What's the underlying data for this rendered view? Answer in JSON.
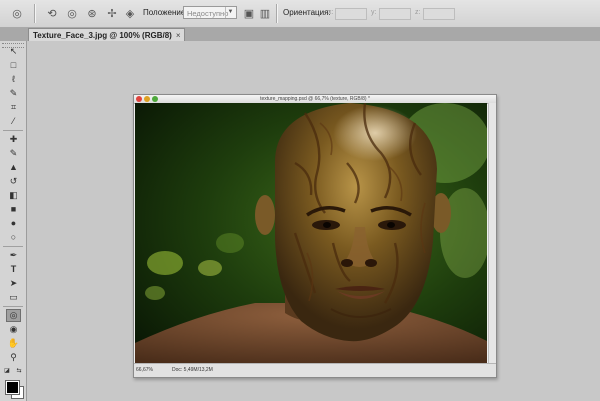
{
  "options_bar": {
    "position_label": "Положение:",
    "position_value": "Недоступно",
    "orientation_label": "Ориентация:",
    "orientation_fields": [
      "x:",
      "y:",
      "z:"
    ]
  },
  "document_tab": {
    "label": "Texture_Face_3.jpg @ 100% (RGB/8)",
    "close": "×"
  },
  "document_window": {
    "title": "texture_mapping.psd @ 66,7% (texture, RGB/8) *",
    "zoom": "66,67%",
    "doc_info": "Doc: 5,49M/13,2M"
  },
  "icons": {
    "tool_move": "↖",
    "tool_marquee": "□",
    "tool_lasso": "ℓ",
    "tool_quick_select": "✎",
    "tool_crop": "⌗",
    "tool_eyedropper": "⁄",
    "tool_heal": "✚",
    "tool_brush": "✎",
    "tool_stamp": "▲",
    "tool_history": "↺",
    "tool_eraser": "◧",
    "tool_gradient": "■",
    "tool_blur": "●",
    "tool_dodge": "○",
    "tool_pen": "✒",
    "tool_type": "T",
    "tool_path_select": "➤",
    "tool_shape": "▭",
    "tool_3d_rotate": "◎",
    "tool_3d_camera": "◉",
    "tool_hand": "✋",
    "tool_zoom": "⚲"
  }
}
